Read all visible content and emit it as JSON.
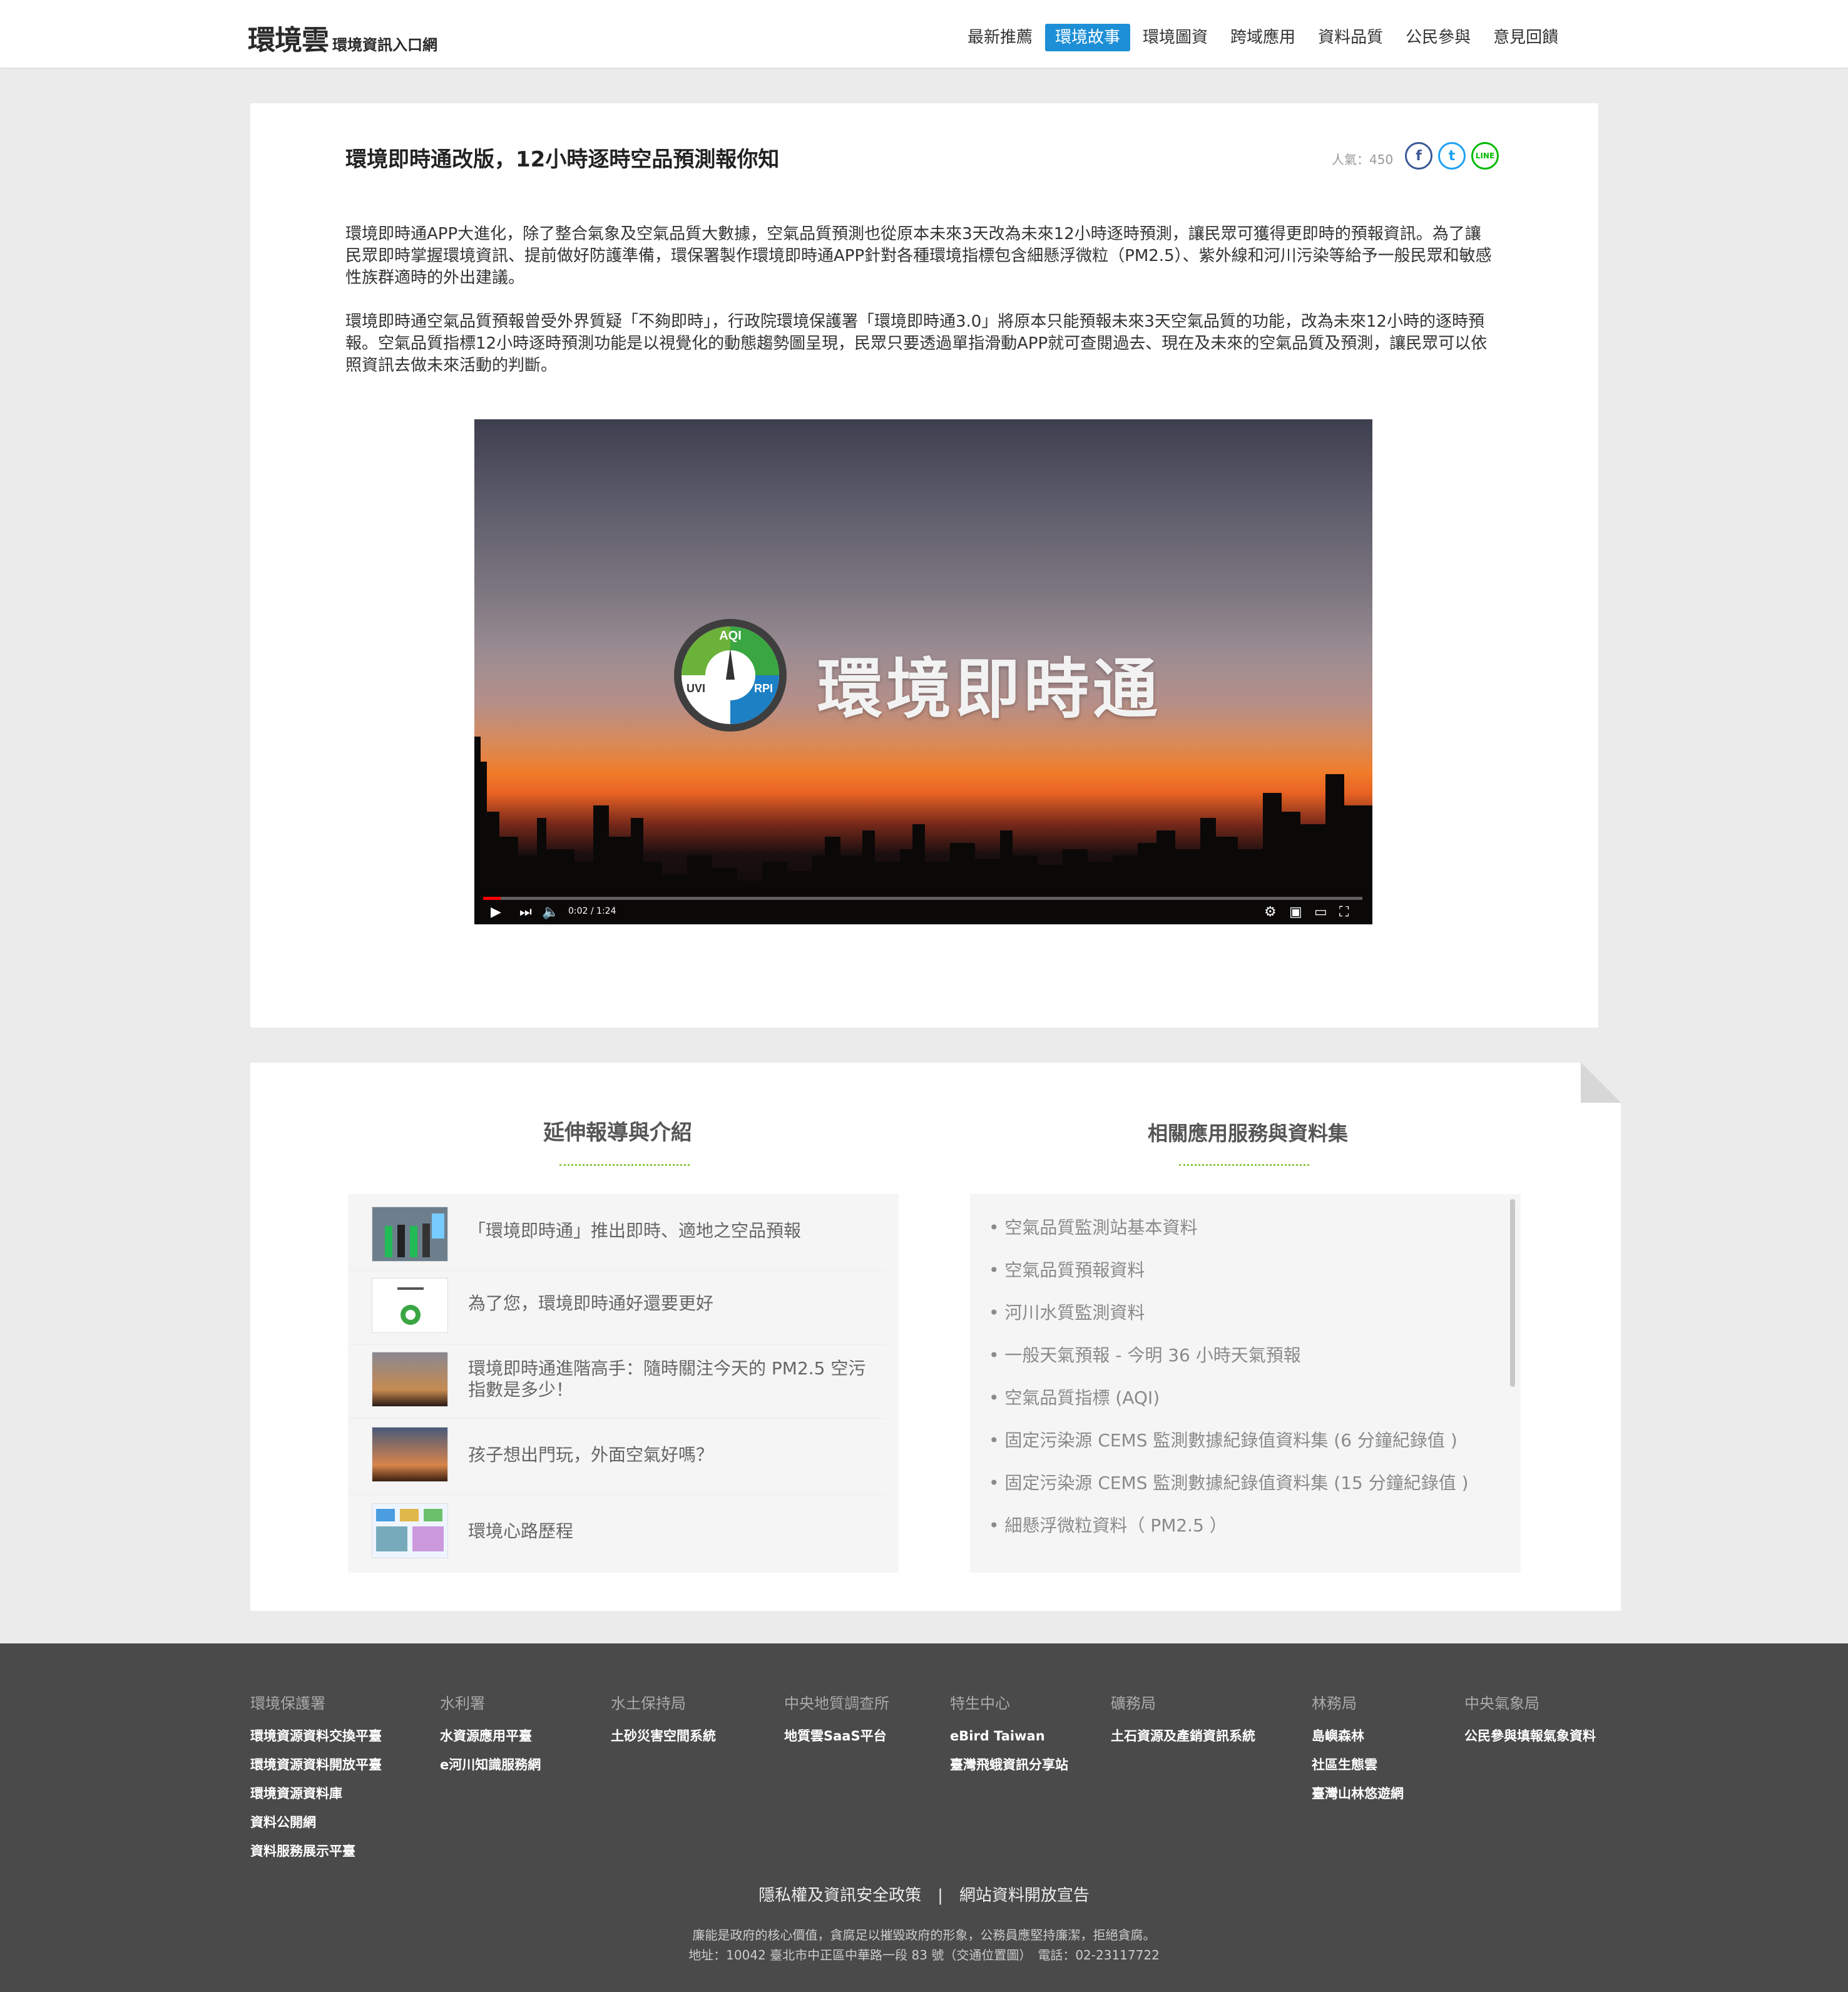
{
  "header": {
    "logo_main": "環境雲",
    "logo_sub": "環境資訊入口網",
    "nav": [
      "最新推薦",
      "環境故事",
      "環境圖資",
      "跨域應用",
      "資料品質",
      "公民參與",
      "意見回饋"
    ],
    "nav_active_index": 1
  },
  "colors": {
    "accent": "#1d8fd6",
    "green": "#8cc63f",
    "footer_bg": "#4a4a4a"
  },
  "article": {
    "title": "環境即時通改版，12小時逐時空品預測報你知",
    "popularity": "人氣：450",
    "share": {
      "facebook": "f",
      "twitter": "t",
      "line": "LINE"
    },
    "paragraph1": "環境即時通APP大進化，除了整合氣象及空氣品質大數據，空氣品質預測也從原本未來3天改為未來12小時逐時預測，讓民眾可獲得更即時的預報資訊。為了讓民眾即時掌握環境資訊、提前做好防護準備，環保署製作環境即時通APP針對各種環境指標包含細懸浮微粒（PM2.5）、紫外線和河川污染等給予一般民眾和敏感性族群適時的外出建議。",
    "paragraph2": "環境即時通空氣品質預報曾受外界質疑「不夠即時」，行政院環境保護署「環境即時通3.0」將原本只能預報未來3天空氣品質的功能，改為未來12小時的逐時預報。空氣品質指標12小時逐時預測功能是以視覺化的動態趨勢圖呈現，民眾只要透過單指滑動APP就可查閱過去、現在及未來的空氣品質及預測，讓民眾可以依照資訊去做未來活動的判斷。",
    "video": {
      "overlay_title": "環境即時通",
      "gauge_top": "AQI",
      "gauge_left": "UVI",
      "gauge_right": "RPI",
      "time": "0:02 / 1:24",
      "progress": 0.02
    }
  },
  "related": {
    "left_title": "延伸報導與介紹",
    "right_title": "相關應用服務與資料集",
    "news": [
      "「環境即時通」推出即時、適地之空品預報",
      "為了您，環境即時通好還要更好",
      "環境即時通進階高手：隨時關注今天的 PM2.5 空污指數是多少！",
      "孩子想出門玩，外面空氣好嗎？",
      "環境心路歷程"
    ],
    "datasets": [
      "• 空氣品質監測站基本資料",
      "• 空氣品質預報資料",
      "• 河川水質監測資料",
      "• 一般天氣預報 - 今明 36 小時天氣預報",
      "• 空氣品質指標 (AQI)",
      "• 固定污染源 CEMS 監測數據紀錄值資料集 (6 分鐘紀錄值 )",
      "• 固定污染源 CEMS 監測數據紀錄值資料集 (15 分鐘紀錄值 )",
      "• 細懸浮微粒資料（ PM2.5 ）"
    ]
  },
  "footer": {
    "columns": [
      {
        "head": "環境保護署",
        "links": [
          "環境資源資料交換平臺",
          "環境資源資料開放平臺",
          "環境資源資料庫",
          "資料公開網",
          "資料服務展示平臺"
        ]
      },
      {
        "head": "水利署",
        "links": [
          "水資源應用平臺",
          "e河川知識服務網"
        ]
      },
      {
        "head": "水土保持局",
        "links": [
          "土砂災害空間系統"
        ]
      },
      {
        "head": "中央地質調查所",
        "links": [
          "地質雲SaaS平台"
        ]
      },
      {
        "head": "特生中心",
        "links": [
          "eBird Taiwan",
          "臺灣飛蛾資訊分享站"
        ]
      },
      {
        "head": "礦務局",
        "links": [
          "土石資源及產銷資訊系統"
        ]
      },
      {
        "head": "林務局",
        "links": [
          "島嶼森林",
          "社區生態雲",
          "臺灣山林悠遊網"
        ]
      },
      {
        "head": "中央氣象局",
        "links": [
          "公民參與填報氣象資料"
        ]
      }
    ],
    "bottom_links": "隱私權及資訊安全政策　|　網站資料開放宣告",
    "note1": "廉能是政府的核心價值，貪腐足以摧毀政府的形象，公務員應堅持廉潔，拒絕貪腐。",
    "note2": "地址：10042 臺北市中正區中華路一段 83 號（交通位置圖）　電話：02-23117722"
  }
}
